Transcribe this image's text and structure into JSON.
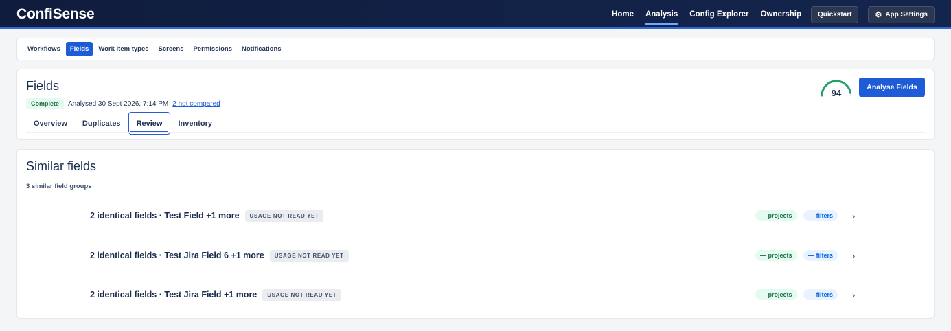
{
  "app": {
    "brand": "ConfiSense",
    "nav": [
      {
        "label": "Home",
        "active": false
      },
      {
        "label": "Analysis",
        "active": true
      },
      {
        "label": "Config Explorer",
        "active": false
      },
      {
        "label": "Ownership",
        "active": false
      }
    ],
    "quickstart_label": "Quickstart",
    "settings_label": "App Settings",
    "accent_color": "#1d5bd7"
  },
  "subnav": {
    "items": [
      {
        "label": "Workflows",
        "active": false
      },
      {
        "label": "Fields",
        "active": true
      },
      {
        "label": "Work item types",
        "active": false
      },
      {
        "label": "Screens",
        "active": false
      },
      {
        "label": "Permissions",
        "active": false
      },
      {
        "label": "Notifications",
        "active": false
      }
    ]
  },
  "fields": {
    "title": "Fields",
    "status": "Complete",
    "analysed": "Analysed 30 Sept 2026, 7:14 PM",
    "not_compared": "2 not compared",
    "score": "94",
    "score_fraction": 0.94,
    "analyse_button": "Analyse Fields",
    "tabs": [
      {
        "label": "Overview",
        "active": false
      },
      {
        "label": "Duplicates",
        "active": false
      },
      {
        "label": "Review",
        "active": true
      },
      {
        "label": "Inventory",
        "active": false
      }
    ]
  },
  "similar": {
    "title": "Similar fields",
    "group_count": "3 similar field groups",
    "groups": [
      {
        "title": "2 identical fields · Test Field +1 more",
        "usage": "USAGE NOT READ YET",
        "projects": "— projects",
        "filters": "— filters"
      },
      {
        "title": "2 identical fields · Test Jira Field 6 +1 more",
        "usage": "USAGE NOT READ YET",
        "projects": "— projects",
        "filters": "— filters"
      },
      {
        "title": "2 identical fields · Test Jira Field +1 more",
        "usage": "USAGE NOT READ YET",
        "projects": "— projects",
        "filters": "— filters"
      }
    ]
  }
}
